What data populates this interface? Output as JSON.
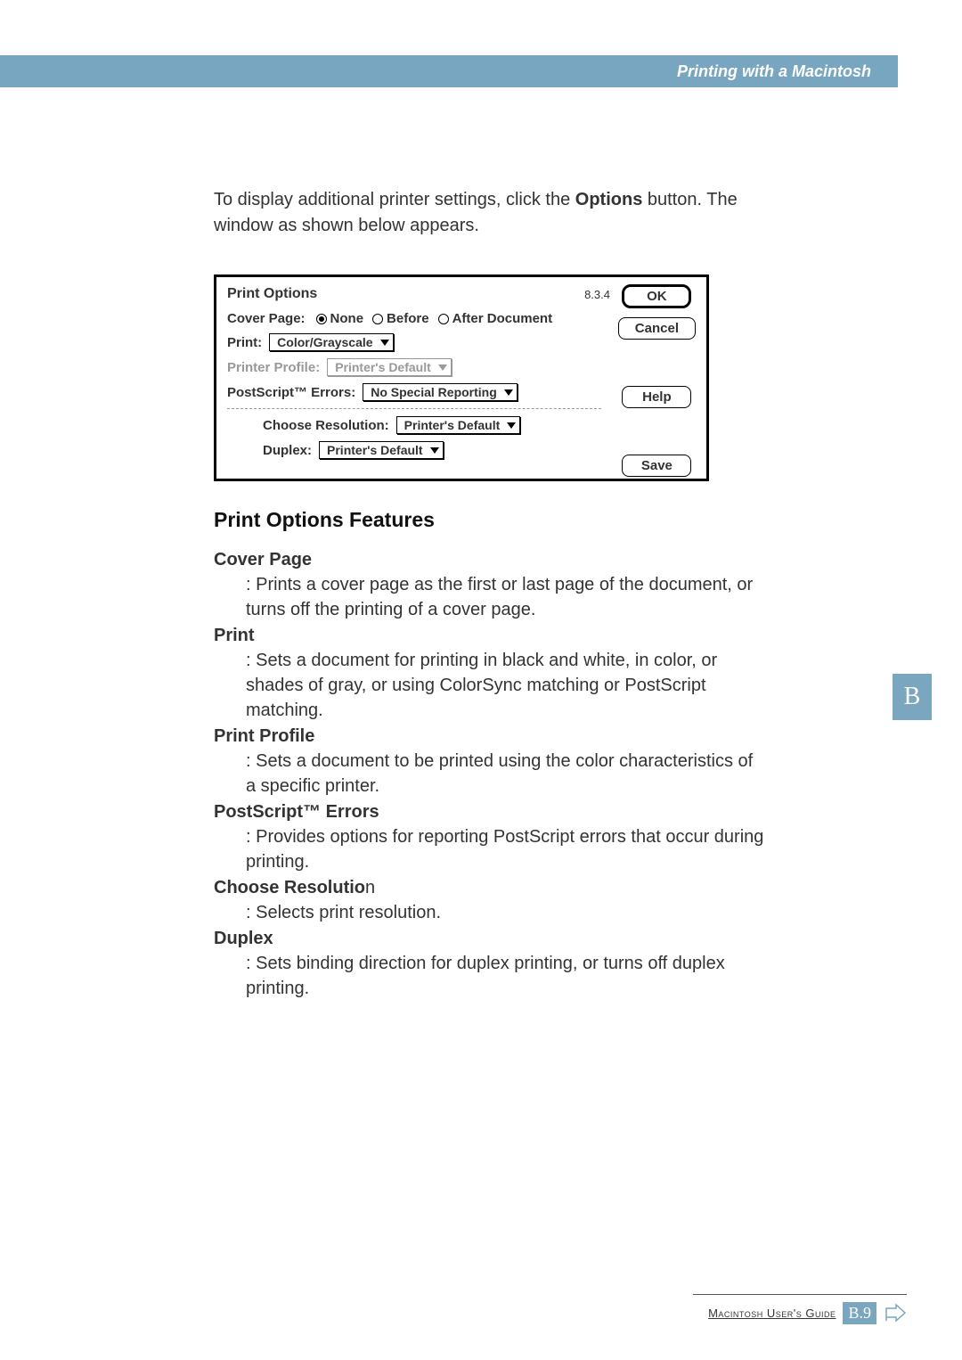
{
  "header": {
    "title": "Printing with a Macintosh"
  },
  "intro": {
    "prefix": "To display additional printer settings, click the ",
    "bold": "Options",
    "suffix": " button. The window as shown below appears."
  },
  "dialog": {
    "title": "Print Options",
    "version": "8.3.4",
    "cover_page_label": "Cover Page:",
    "cover_none": "None",
    "cover_before": "Before",
    "cover_after": "After Document",
    "print_label": "Print:",
    "print_value": "Color/Grayscale",
    "printer_profile_label": "Printer Profile:",
    "printer_profile_value": "Printer's Default",
    "ps_errors_label": "PostScript™ Errors:",
    "ps_errors_value": "No Special Reporting",
    "resolution_label": "Choose Resolution:",
    "resolution_value": "Printer's Default",
    "duplex_label": "Duplex:",
    "duplex_value": "Printer's Default",
    "buttons": {
      "ok": "OK",
      "cancel": "Cancel",
      "help": "Help",
      "save": "Save"
    }
  },
  "section_title": "Print Options Features",
  "features": {
    "cover_page": {
      "title": "Cover Page",
      "desc": ": Prints a cover page as the first or last page of the document, or turns off the printing of a cover page."
    },
    "print": {
      "title": "Print",
      "desc": ": Sets a document for printing in black and white, in color, or shades of gray, or using ColorSync matching or PostScript matching."
    },
    "print_profile": {
      "title": "Print Profile",
      "desc": ": Sets a document to be printed using the color characteristics of a specific printer."
    },
    "ps_errors": {
      "title": "PostScript™ Errors",
      "desc": ": Provides options for reporting PostScript errors that occur during printing."
    },
    "resolution": {
      "title_bold": "Choose Resolutio",
      "title_tail": "n",
      "desc": ": Selects print resolution."
    },
    "duplex": {
      "title": "Duplex",
      "desc": ": Sets binding direction for duplex printing, or turns off duplex printing."
    }
  },
  "side_tab": "B",
  "footer": {
    "text": "Macintosh User's Guide",
    "page": "B.9"
  }
}
